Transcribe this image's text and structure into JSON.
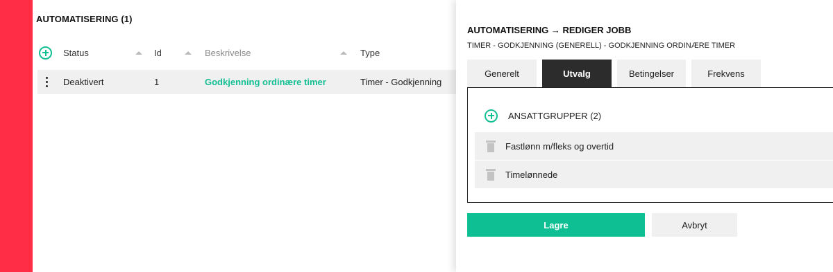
{
  "list": {
    "title": "AUTOMATISERING (1)",
    "columns": [
      "Status",
      "Id",
      "Beskrivelse",
      "Type"
    ],
    "rows": [
      {
        "status": "Deaktivert",
        "id": "1",
        "beskrivelse": "Godkjenning ordinære timer",
        "type": "Timer - Godkjenning"
      }
    ]
  },
  "panel": {
    "title": "AUTOMATISERING → REDIGER JOBB",
    "subtitle": "TIMER - GODKJENNING (GENERELL) - GODKJENNING ORDINÆRE TIMER",
    "tabs": [
      {
        "label": "Generelt",
        "active": false
      },
      {
        "label": "Utvalg",
        "active": true
      },
      {
        "label": "Betingelser",
        "active": false
      },
      {
        "label": "Frekvens",
        "active": false
      }
    ],
    "group_header": "ANSATTGRUPPER (2)",
    "groups": [
      "Fastlønn m/fleks og overtid",
      "Timelønnede"
    ],
    "save_label": "Lagre",
    "cancel_label": "Avbryt"
  },
  "colors": {
    "accent": "#12bf93",
    "side_strip": "#ff2d46",
    "active_tab": "#2c2c2c"
  }
}
